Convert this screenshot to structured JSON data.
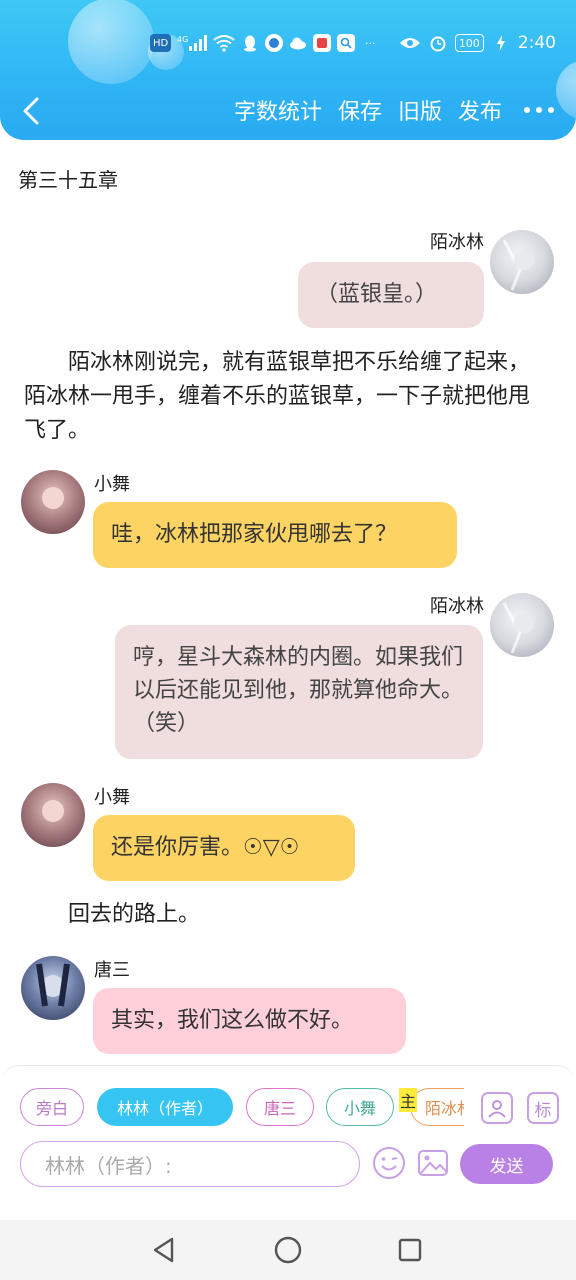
{
  "status_bar": {
    "hd": "HD",
    "network": "4G",
    "battery": "100",
    "time": "2:40",
    "ellipsis": "···"
  },
  "toolbar": {
    "word_count": "字数统计",
    "save": "保存",
    "old_version": "旧版",
    "publish": "发布"
  },
  "chapter_title": "第三十五章",
  "messages": [
    {
      "sender": "陌冰林",
      "text": "（蓝银皇。）"
    },
    {
      "narration": "　　陌冰林刚说完，就有蓝银草把不乐给缠了起来，陌冰林一甩手，缠着不乐的蓝银草，一下子就把他甩飞了。"
    },
    {
      "sender": "小舞",
      "text": "哇，冰林把那家伙甩哪去了？"
    },
    {
      "sender": "陌冰林",
      "text": "哼，星斗大森林的内圈。如果我们以后还能见到他，那就算他命大。（笑）"
    },
    {
      "sender": "小舞",
      "text": "还是你厉害。☉▽☉"
    },
    {
      "narration": "　　回去的路上。"
    },
    {
      "sender": "唐三",
      "text": "其实，我们这么做不好。"
    }
  ],
  "composer": {
    "chips": [
      "旁白",
      "林林（作者）",
      "唐三",
      "小舞",
      "陌冰林"
    ],
    "main_marker": "主",
    "biao": "标",
    "input_placeholder": "林林（作者）:",
    "send": "发送"
  },
  "colors": {
    "header": "#2fb4f4",
    "bubble_gray": "#f0dede",
    "bubble_yellow": "#fdd463",
    "bubble_pink": "#ffd0da",
    "send_button": "#b981e6"
  }
}
